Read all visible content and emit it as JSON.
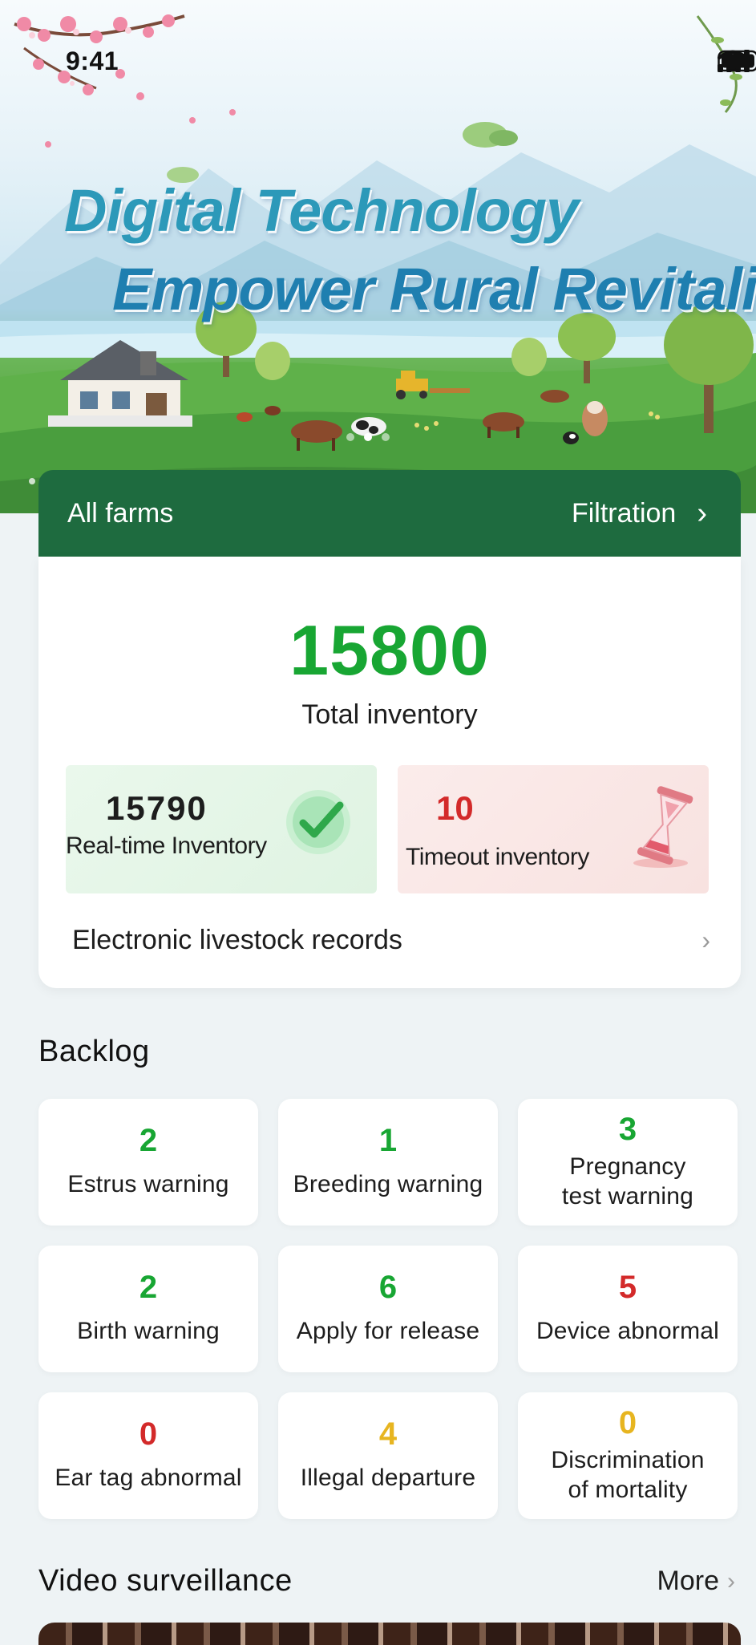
{
  "status_bar": {
    "time": "9:41",
    "icons": [
      "signal-icon",
      "wifi-icon",
      "battery-icon"
    ]
  },
  "hero": {
    "line1": "Digital Technology",
    "line2": "Empower Rural Revitalization",
    "slides": 3,
    "active_slide": 1
  },
  "farm_bar": {
    "label": "All farms",
    "filter_label": "Filtration",
    "filter_chevron": "›"
  },
  "inventory": {
    "total_value": "15800",
    "total_label": "Total inventory",
    "realtime_value": "15790",
    "realtime_label": "Real-time Inventory",
    "timeout_value": "10",
    "timeout_label": "Timeout inventory",
    "records_label": "Electronic livestock records",
    "records_chevron": "›"
  },
  "backlog": {
    "title": "Backlog",
    "tiles": [
      {
        "count": "2",
        "label": "Estrus warning",
        "color": "#18a633"
      },
      {
        "count": "1",
        "label": "Breeding warning",
        "color": "#18a633"
      },
      {
        "count": "3",
        "label_line1": "Pregnancy",
        "label_line2": "test warning",
        "color": "#18a633"
      },
      {
        "count": "2",
        "label": "Birth warning",
        "color": "#18a633"
      },
      {
        "count": "6",
        "label": "Apply for release",
        "color": "#18a633"
      },
      {
        "count": "5",
        "label": "Device abnormal",
        "color": "#d32a2a"
      },
      {
        "count": "0",
        "label": "Ear tag abnormal",
        "color": "#d32a2a"
      },
      {
        "count": "4",
        "label": "Illegal departure",
        "color": "#e7b520"
      },
      {
        "count": "0",
        "label_line1": "Discrimination",
        "label_line2": "of mortality",
        "color": "#e7b520"
      }
    ]
  },
  "video": {
    "title": "Video surveillance",
    "more_label": "More",
    "more_chevron": "›"
  },
  "colors": {
    "brand_green": "#1e6b3f",
    "value_green": "#18a633",
    "alert_red": "#d32a2a",
    "warn_yellow": "#e7b520",
    "background": "#eef3f5"
  }
}
